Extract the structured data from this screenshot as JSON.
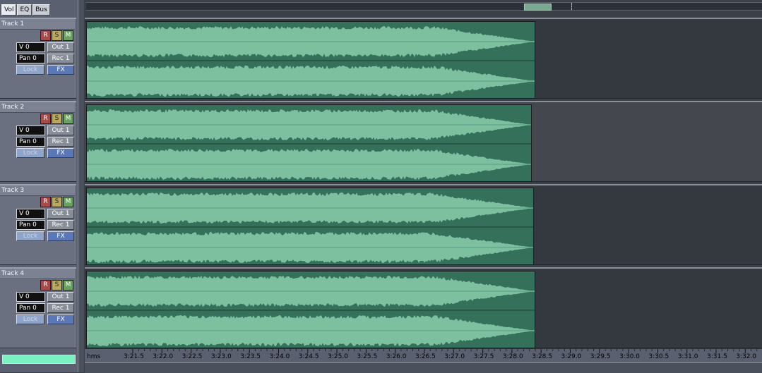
{
  "tabs": [
    {
      "label": "Vol",
      "active": true
    },
    {
      "label": "EQ",
      "active": false
    },
    {
      "label": "Bus",
      "active": false
    }
  ],
  "tracks": [
    {
      "name": "Track 1",
      "rec": "R",
      "solo": "S",
      "mute": "M",
      "volume": "V 0",
      "pan": "Pan 0",
      "output": "Out 1",
      "record_input": "Rec 1",
      "lock": "Lock",
      "fx": "FX",
      "clip_end": "3:28.2"
    },
    {
      "name": "Track 2",
      "rec": "R",
      "solo": "S",
      "mute": "M",
      "volume": "V 0",
      "pan": "Pan 0",
      "output": "Out 1",
      "record_input": "Rec 1",
      "lock": "Lock",
      "fx": "FX",
      "clip_end": "3:28.2"
    },
    {
      "name": "Track 3",
      "rec": "R",
      "solo": "S",
      "mute": "M",
      "volume": "V 0",
      "pan": "Pan 0",
      "output": "Out 1",
      "record_input": "Rec 1",
      "lock": "Lock",
      "fx": "FX",
      "clip_end": "3:28.2"
    },
    {
      "name": "Track 4",
      "rec": "R",
      "solo": "S",
      "mute": "M",
      "volume": "V 0",
      "pan": "Pan 0",
      "output": "Out 1",
      "record_input": "Rec 1",
      "lock": "Lock",
      "fx": "FX",
      "clip_end": "3:28.2"
    }
  ],
  "ruler": {
    "unit": "hms",
    "ticks": [
      "3:21.5",
      "3:22.0",
      "3:22.5",
      "3:23.0",
      "3:23.5",
      "3:24.0",
      "3:24.5",
      "3:25.0",
      "3:25.5",
      "3:26.0",
      "3:26.5",
      "3:27.0",
      "3:27.5",
      "3:28.0",
      "3:28.5",
      "3:29.0",
      "3:29.5",
      "3:30.0",
      "3:30.5",
      "3:31.0",
      "3:31.5",
      "3:32.0"
    ]
  },
  "colors": {
    "waveform": "#7cc0a0",
    "clip_background": "#34705a",
    "level_meter": "#7bf0c0",
    "panel": "#6a7080"
  }
}
